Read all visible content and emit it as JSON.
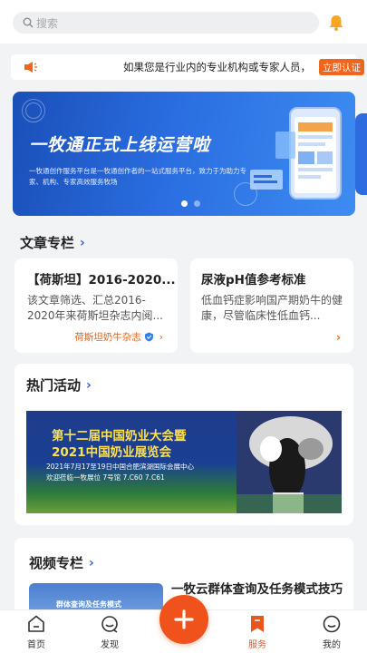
{
  "search": {
    "placeholder": "搜索"
  },
  "notice": {
    "text": "如果您是行业内的专业机构或专家人员，",
    "button": "立即认证"
  },
  "banner": {
    "title": "一牧通正式上线运营啦",
    "subtitle": "一牧通创作服务平台是一牧通创作者的一站式服务平台，致力于为助力专家、机构、专家高效服务牧场",
    "active_slide": 1,
    "slide_count": 2
  },
  "articles": {
    "section_title": "文章专栏",
    "items": [
      {
        "title": "【荷斯坦】2016-2020...",
        "desc": "该文章筛选、汇总2016-2020年来荷斯坦杂志内阅...",
        "source": "荷斯坦奶牛杂志"
      },
      {
        "title": "尿液pH值参考标准",
        "desc": "低血钙症影响国产期奶牛的健康，尽管临床性低血钙..."
      }
    ]
  },
  "activities": {
    "section_title": "热门活动",
    "poster": {
      "line1": "第十二届中国奶业大会暨",
      "line2": "2021中国奶业展览会",
      "line3": "2021年7月17至19日中国合肥滨湖国际会展中心",
      "line4": "欢迎莅临一牧展位  7号馆  7.C60  7.C61"
    }
  },
  "videos": {
    "section_title": "视频专栏",
    "thumb_text": "群体查询及任务模式",
    "title": "一牧云群体查询及任务模式技巧"
  },
  "tabbar": {
    "items": [
      {
        "label": "首页",
        "icon": "home-icon"
      },
      {
        "label": "发现",
        "icon": "discover-icon"
      },
      {
        "label": "服务",
        "icon": "service-icon"
      },
      {
        "label": "我的",
        "icon": "profile-icon"
      }
    ],
    "active": "服务",
    "fab_icon": "plus-icon"
  },
  "colors": {
    "accent": "#f0521c",
    "link": "#3a5fd6",
    "banner": "#2a6de0"
  }
}
